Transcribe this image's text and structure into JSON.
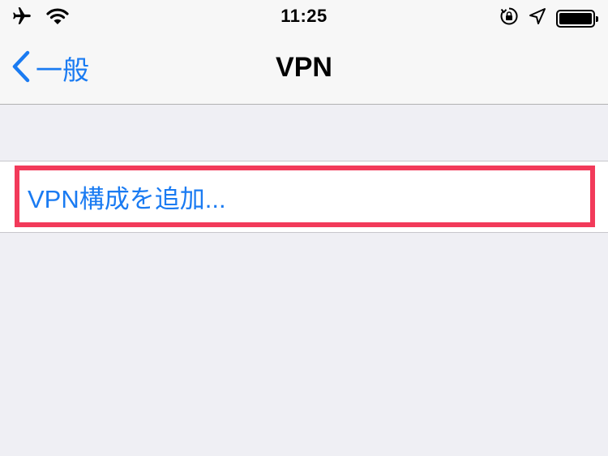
{
  "status_bar": {
    "time": "11:25",
    "icons": [
      "airplane-icon",
      "wifi-icon",
      "orientation-lock-icon",
      "location-icon",
      "battery-icon"
    ]
  },
  "nav": {
    "back_label": "一般",
    "title": "VPN"
  },
  "list": {
    "add_vpn_label": "VPN構成を追加..."
  },
  "colors": {
    "accent": "#1a7bf2",
    "highlight": "#f23a5a",
    "background": "#efeff4"
  }
}
